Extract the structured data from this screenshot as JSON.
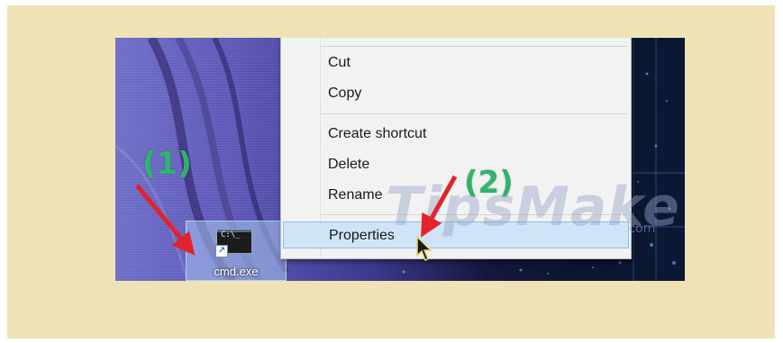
{
  "desktop": {
    "shortcut_label": "cmd.exe",
    "cmd_prompt_text": "C:\\_"
  },
  "context_menu": {
    "items": [
      {
        "label": "Cut"
      },
      {
        "label": "Copy"
      },
      {
        "label": "Create shortcut"
      },
      {
        "label": "Delete"
      },
      {
        "label": "Rename"
      },
      {
        "label": "Properties",
        "highlighted": true
      }
    ]
  },
  "annotations": {
    "step1": "(1)",
    "step2": "(2)",
    "color": "#2fb46e",
    "arrow_color": "#e3232b"
  },
  "watermark": {
    "text": "TipsMake",
    "suffix": ".com"
  }
}
